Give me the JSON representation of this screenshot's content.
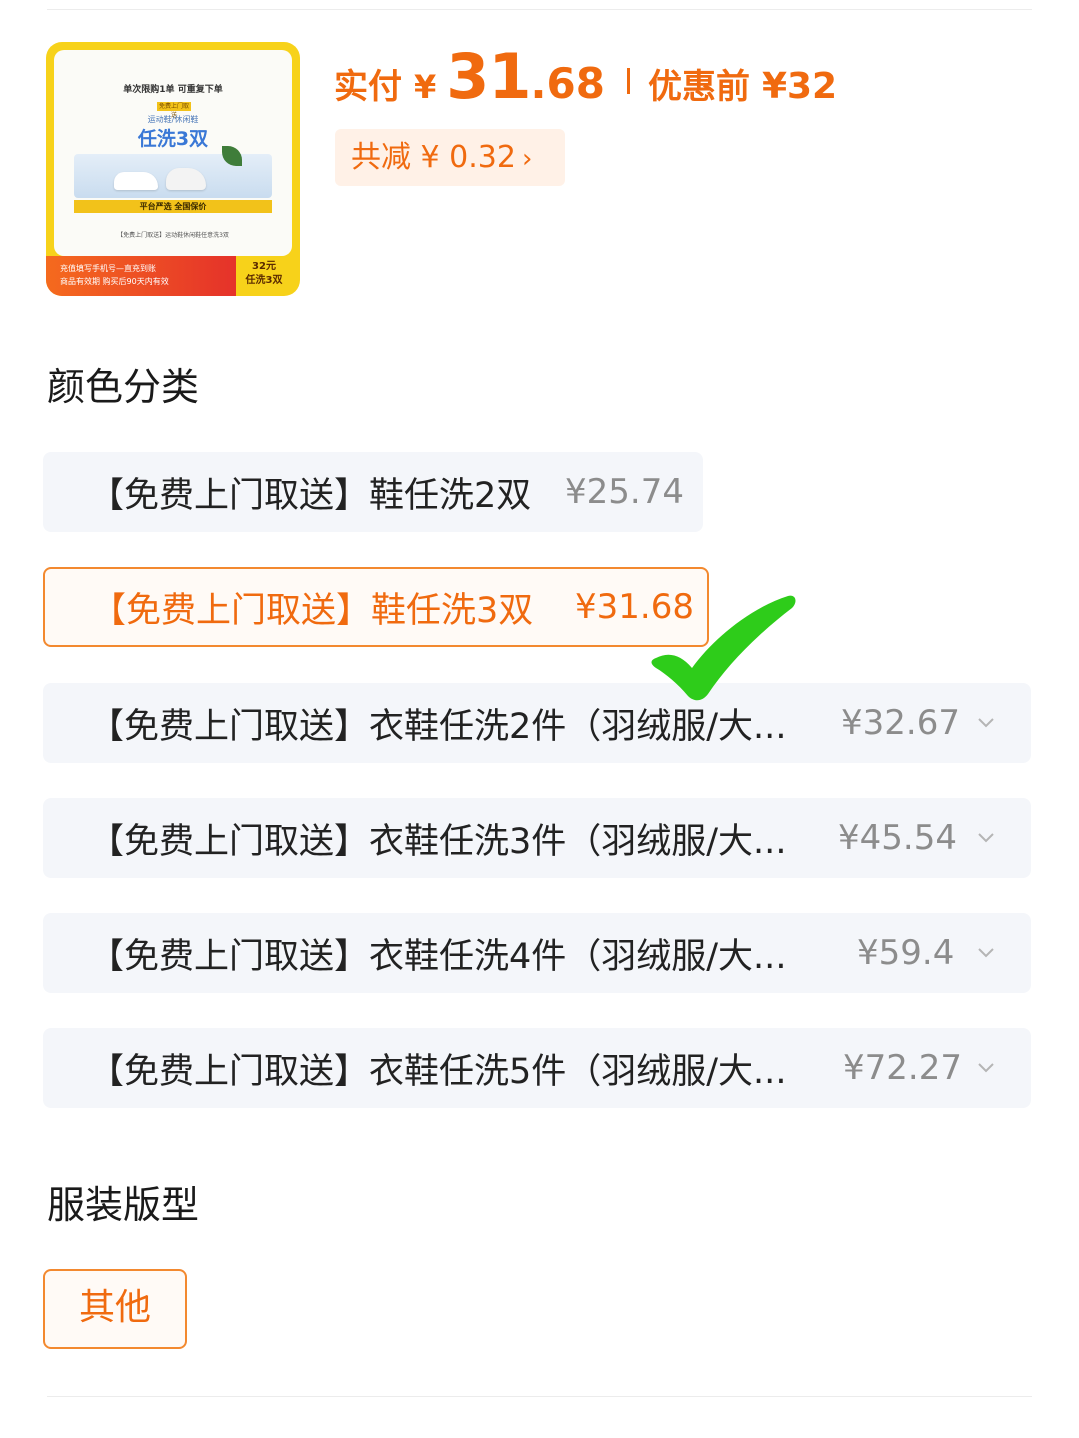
{
  "product_image": {
    "headline": "单次限购1单 可重复下单",
    "tag": "免费上门取送",
    "subtitle": "运动鞋/休闲鞋",
    "main_text": "任洗3双",
    "bar_text": "平台严选 全国保价",
    "small_text": "【免费上门取送】运动鞋休闲鞋任意洗3双",
    "banner_line1": "充值填写手机号—直充到账",
    "banner_line2": "商品有效期 购买后90天内有效",
    "badge_line1": "32元",
    "badge_line2": "任洗3双"
  },
  "price": {
    "pay_label": "实付",
    "currency": "¥",
    "amount_int": "31",
    "amount_dec": ".68",
    "original_label": "优惠前",
    "original_price": "¥32",
    "saving_text": "共减 ¥ 0.32",
    "saving_chevron": "›"
  },
  "color_section": {
    "title": "颜色分类",
    "options": [
      {
        "name": "【免费上门取送】鞋任洗2双",
        "price": "¥25.74",
        "selected": false,
        "has_dropdown": false
      },
      {
        "name": "【免费上门取送】鞋任洗3双",
        "price": "¥31.68",
        "selected": true,
        "has_dropdown": false
      },
      {
        "name": "【免费上门取送】衣鞋任洗2件（羽绒服/大...",
        "price": "¥32.67",
        "selected": false,
        "has_dropdown": true
      },
      {
        "name": "【免费上门取送】衣鞋任洗3件（羽绒服/大...",
        "price": "¥45.54",
        "selected": false,
        "has_dropdown": true
      },
      {
        "name": "【免费上门取送】衣鞋任洗4件（羽绒服/大...",
        "price": "¥59.4",
        "selected": false,
        "has_dropdown": true
      },
      {
        "name": "【免费上门取送】衣鞋任洗5件（羽绒服/大...",
        "price": "¥72.27",
        "selected": false,
        "has_dropdown": true
      }
    ]
  },
  "fit_section": {
    "title": "服装版型",
    "option": "其他"
  },
  "colors": {
    "accent": "#f06a0f",
    "selected_border": "#f3892f",
    "option_bg": "#f4f6fa",
    "check_mark": "#2ecc1a"
  },
  "icons": {
    "check": "green-check-mark-icon",
    "dropdown": "chevron-down-icon"
  }
}
